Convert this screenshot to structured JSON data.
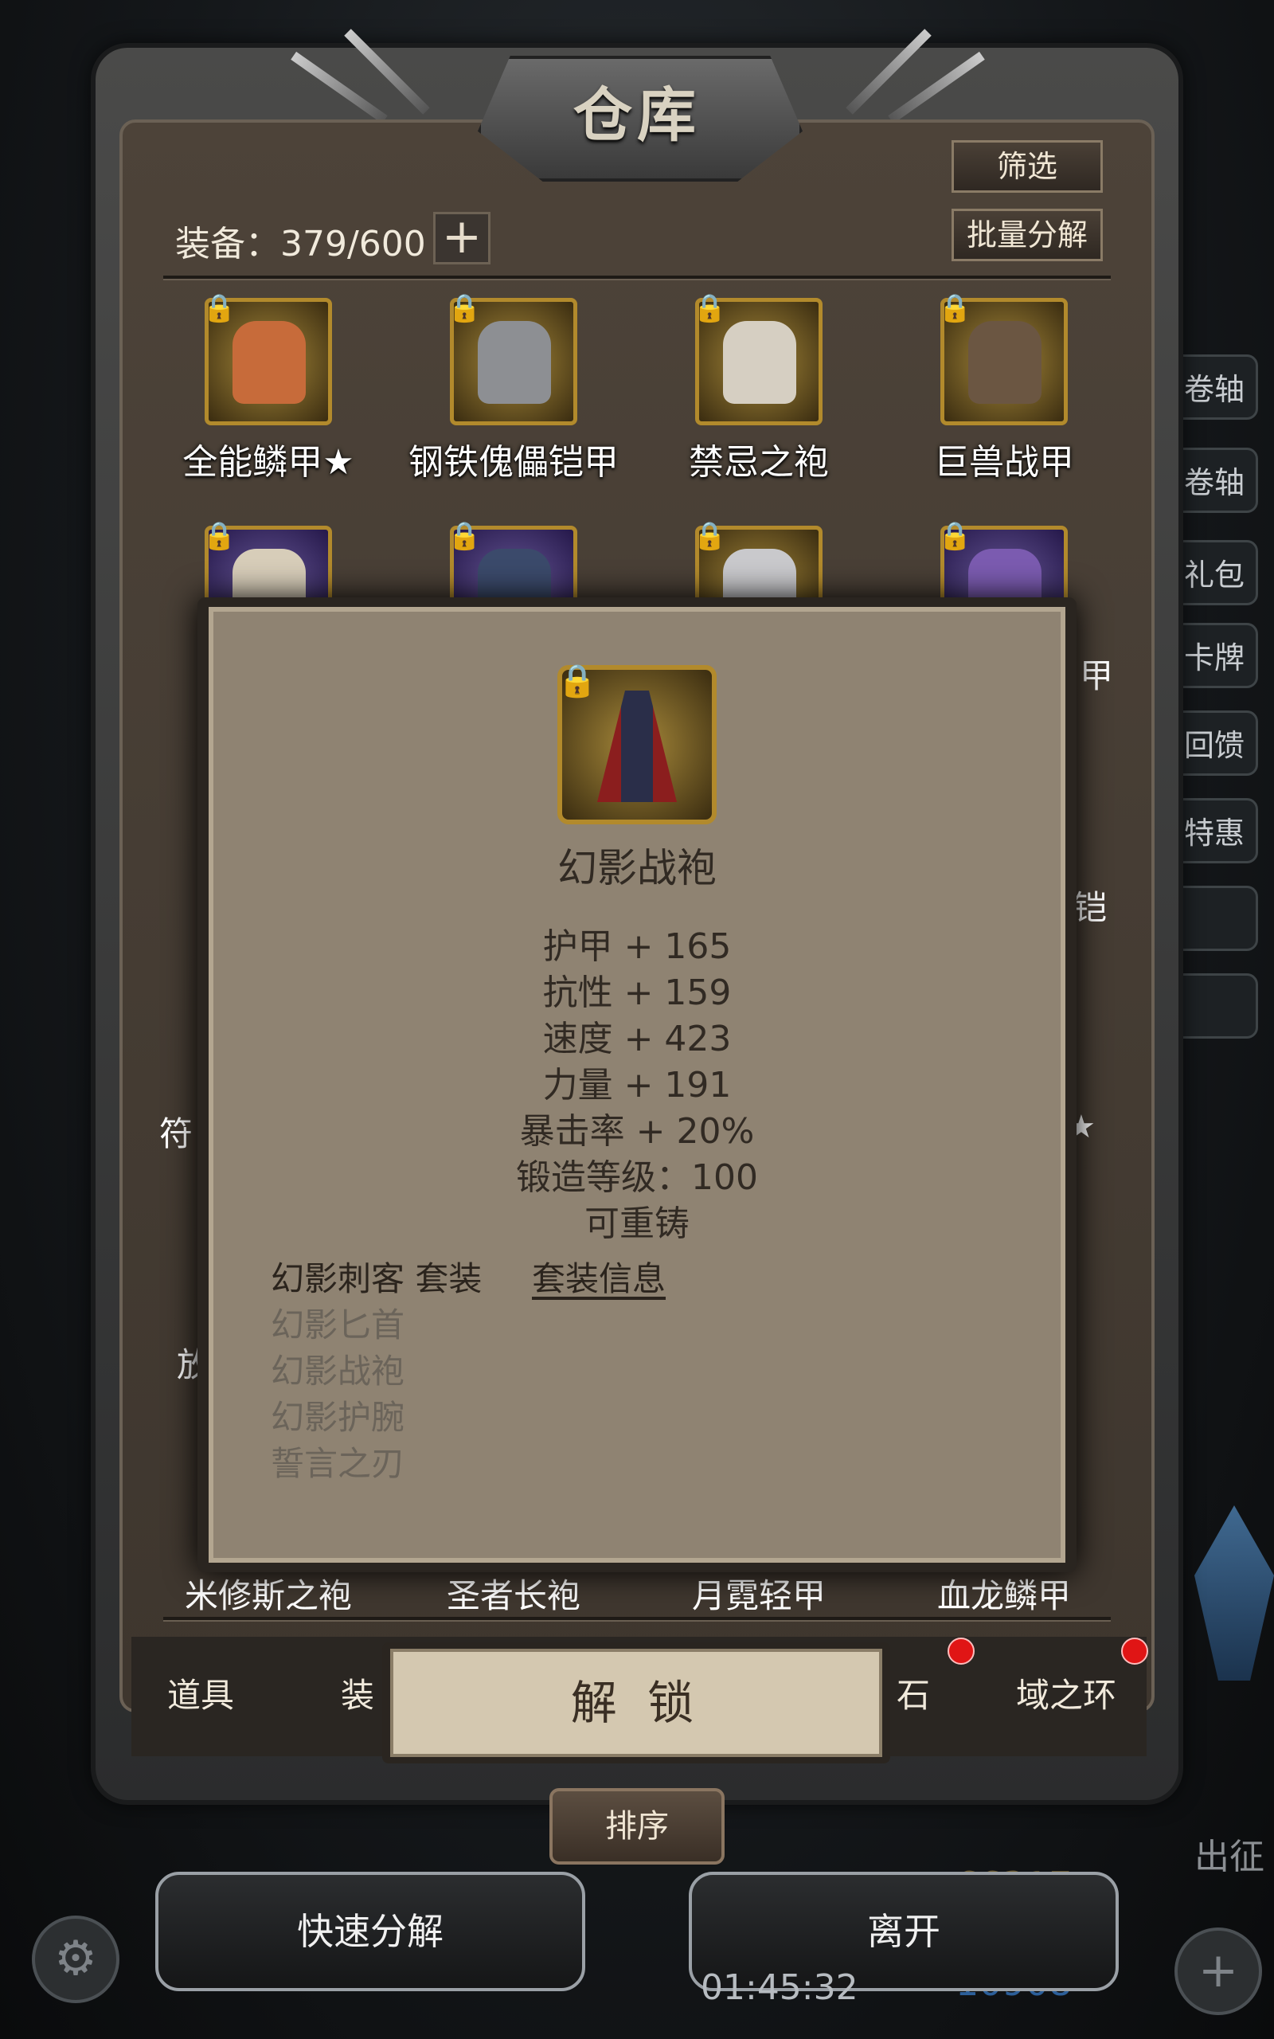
{
  "window": {
    "title": "仓库"
  },
  "top_buttons": {
    "filter": "筛选",
    "batch_decompose": "批量分解"
  },
  "capacity": {
    "label": "装备：379/600",
    "plus": "+"
  },
  "items": [
    {
      "name": "全能鳞甲★",
      "color": "#c76b3a"
    },
    {
      "name": "钢铁傀儡铠甲",
      "color": "#8d8f93"
    },
    {
      "name": "禁忌之袍",
      "color": "#d6cfc2"
    },
    {
      "name": "巨兽战甲",
      "color": "#6b5642"
    }
  ],
  "hidden_row_names": [
    "米修斯之袍",
    "圣者长袍",
    "月霓轻甲",
    "血龙鳞甲"
  ],
  "partial_labels": {
    "left1": "符",
    "left2": "放",
    "right1": "甲",
    "right2": "铠",
    "right3": "★"
  },
  "side_tabs": [
    "卷轴",
    "卷轴",
    "礼包",
    "卡牌",
    "回馈",
    "特惠",
    "",
    ""
  ],
  "popup": {
    "name": "幻影战袍",
    "stats": [
      "护甲 + 165",
      "抗性 + 159",
      "速度 + 423",
      "力量 + 191",
      "暴击率 + 20%",
      "锻造等级：100",
      "可重铸"
    ],
    "set_title": "幻影刺客 套装",
    "set_info": "套装信息",
    "set_pieces": [
      "幻影匕首",
      "幻影战袍",
      "幻影护腕",
      "誓言之刃"
    ],
    "unlock_label": "解 锁"
  },
  "tabs": {
    "items": "道具",
    "equip": "装",
    "stone": "石",
    "ring": "域之环"
  },
  "sort_label": "排序",
  "bottom": {
    "quick_decompose": "快速分解",
    "leave": "离开",
    "timer": "01:45:32",
    "gold": "66317",
    "gems": "10908",
    "sortie": "出征"
  },
  "icons": {
    "settings": "gear-icon",
    "add": "plus-icon"
  }
}
